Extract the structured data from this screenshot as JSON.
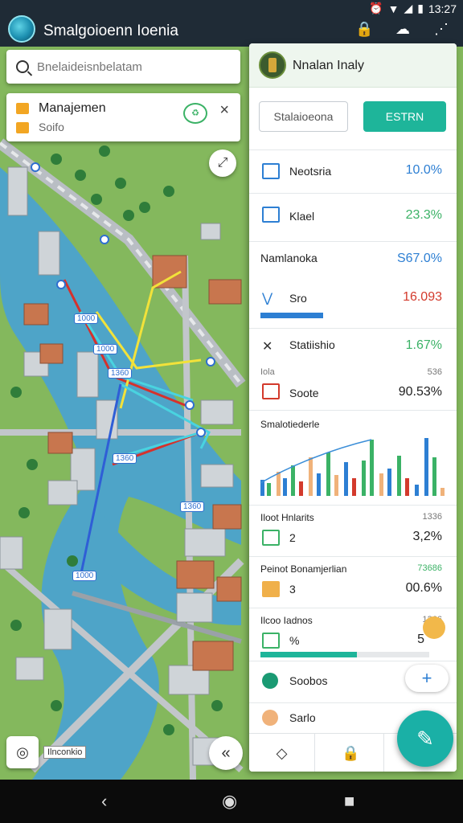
{
  "status_bar": {
    "time": "13:27"
  },
  "app_bar": {
    "title": "Smalgoioenn Ioenia",
    "icons": [
      "lock-icon",
      "cloud-icon",
      "share-icon"
    ]
  },
  "search": {
    "placeholder": "Bnelaideisnbelatam"
  },
  "management_card": {
    "title": "Manajemen",
    "subtitle": "Soifo",
    "close": "×"
  },
  "map_labels": [
    {
      "text": "1000"
    },
    {
      "text": "1000"
    },
    {
      "text": "1360"
    },
    {
      "text": "1360"
    },
    {
      "text": "1360"
    },
    {
      "text": "1000"
    }
  ],
  "map_caption": "Ilnconkio",
  "panel": {
    "title": "Nnalan Inaly",
    "button_outline": "Stalaioeona",
    "button_filled": "ESTRN",
    "rows": {
      "r1": {
        "label": "Neotsria",
        "value": "10.0%"
      },
      "r2": {
        "label": "Klael",
        "value": "23.3%"
      },
      "r3": {
        "label": "Namlanoka",
        "value": "S67.0%",
        "label2": "Sro",
        "value2": "16.093"
      },
      "r4": {
        "label": "Statiishio",
        "value": "1.67%",
        "sub": "Iola",
        "sub_value": "536",
        "label2": "Soote",
        "value2": "90.53%"
      },
      "chart_title": "Smalotiederle",
      "r5": {
        "label": "Iloot Hnlarits",
        "small": "1336",
        "num": "2",
        "value": "3,2%"
      },
      "r6": {
        "label": "Peinot Bonamjerlian",
        "small": "73686",
        "num": "3",
        "value": "00.6%"
      },
      "r7": {
        "label": "Ilcoo Iadnos",
        "small": "1366",
        "num": "%",
        "value": "5"
      },
      "r8": {
        "label": "Soobos"
      },
      "r9": {
        "label": "Sarlo"
      }
    },
    "tab_icons": [
      "home-icon",
      "lock-icon",
      "more-icon"
    ]
  },
  "colors": {
    "accent": "#1eb59a",
    "blue_value": "#2d7fd3",
    "green_value": "#3bb266",
    "red_value": "#d33a2c",
    "map_green": "#7fb35a",
    "river": "#4ea4c8"
  }
}
